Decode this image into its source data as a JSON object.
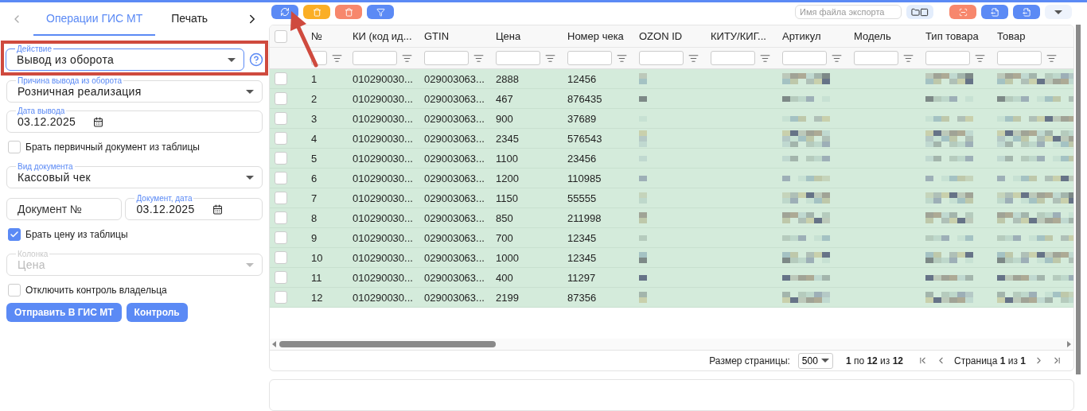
{
  "left_panel": {
    "tabs": [
      {
        "label": "Операции ГИС МТ",
        "selected": true
      },
      {
        "label": "Печать",
        "selected": false
      }
    ],
    "tab_prev_disabled": true,
    "action": {
      "label": "Действие",
      "value": "Вывод из оборота",
      "focused": true,
      "highlighted": true
    },
    "fields": [
      {
        "kind": "select",
        "label": "Причина вывода из оборота",
        "value": "Розничная реализация",
        "disabled": false
      },
      {
        "kind": "date",
        "label": "Дата вывода",
        "value": "03.12.2025"
      },
      {
        "kind": "checkbox",
        "label": "Брать первичный документ из таблицы",
        "checked": false
      },
      {
        "kind": "select",
        "label": "Вид документа",
        "value": "Кассовый чек",
        "disabled": false
      },
      {
        "kind": "pair",
        "left": {
          "placeholder": "Документ №"
        },
        "right": {
          "label": "Документ, дата",
          "value": "03.12.2025"
        }
      },
      {
        "kind": "checkbox",
        "label": "Брать цену из таблицы",
        "checked": true
      },
      {
        "kind": "select",
        "label": "Колонка",
        "value": "Цена",
        "disabled": true
      },
      {
        "kind": "checkbox",
        "label": "Отключить контроль владельца",
        "checked": false
      }
    ],
    "buttons": [
      "Отправить В ГИС МТ",
      "Контроль"
    ]
  },
  "toolbar": {
    "export_placeholder": "Имя файла экспорта",
    "arrow_to_refresh": true
  },
  "table": {
    "all_selected": false,
    "columns": [
      {
        "label": "№",
        "kind": "text"
      },
      {
        "label": "КИ (код ид...",
        "kind": "text"
      },
      {
        "label": "GTIN",
        "kind": "text"
      },
      {
        "label": "Цена",
        "kind": "text"
      },
      {
        "label": "Номер чека",
        "kind": "text"
      },
      {
        "label": "OZON ID",
        "kind": "blurred"
      },
      {
        "label": "КИТУ/КИГ...",
        "kind": "empty"
      },
      {
        "label": "Артикул",
        "kind": "blurred"
      },
      {
        "label": "Модель",
        "kind": "empty"
      },
      {
        "label": "Тип товара",
        "kind": "blurred"
      },
      {
        "label": "Товар",
        "kind": "blurred"
      }
    ],
    "rows": [
      {
        "selected": false,
        "cells": [
          "1",
          "010290030...",
          "029003063...",
          "2888",
          "12456"
        ]
      },
      {
        "selected": false,
        "cells": [
          "2",
          "010290030...",
          "029003063...",
          "467",
          "876435"
        ]
      },
      {
        "selected": false,
        "cells": [
          "3",
          "010290030...",
          "029003063...",
          "900",
          "37689"
        ]
      },
      {
        "selected": false,
        "cells": [
          "4",
          "010290030...",
          "029003063...",
          "2345",
          "576543"
        ]
      },
      {
        "selected": false,
        "cells": [
          "5",
          "010290030...",
          "029003063...",
          "1100",
          "23456"
        ]
      },
      {
        "selected": false,
        "cells": [
          "6",
          "010290030...",
          "029003063...",
          "1200",
          "110985"
        ]
      },
      {
        "selected": false,
        "cells": [
          "7",
          "010290030...",
          "029003063...",
          "1150",
          "55555"
        ]
      },
      {
        "selected": false,
        "cells": [
          "8",
          "010290030...",
          "029003063...",
          "850",
          "211998"
        ]
      },
      {
        "selected": false,
        "cells": [
          "9",
          "010290030...",
          "029003063...",
          "700",
          "12345"
        ]
      },
      {
        "selected": false,
        "cells": [
          "10",
          "010290030...",
          "029003063...",
          "1000",
          "12345"
        ]
      },
      {
        "selected": false,
        "cells": [
          "11",
          "010290030...",
          "029003063...",
          "400",
          "11297"
        ]
      },
      {
        "selected": false,
        "cells": [
          "12",
          "010290030...",
          "029003063...",
          "2199",
          "87356"
        ]
      }
    ]
  },
  "pager": {
    "size_label": "Размер страницы:",
    "size": "500",
    "range": "**1** по **12** из **12**",
    "page": "Страница **1** из **1**"
  }
}
